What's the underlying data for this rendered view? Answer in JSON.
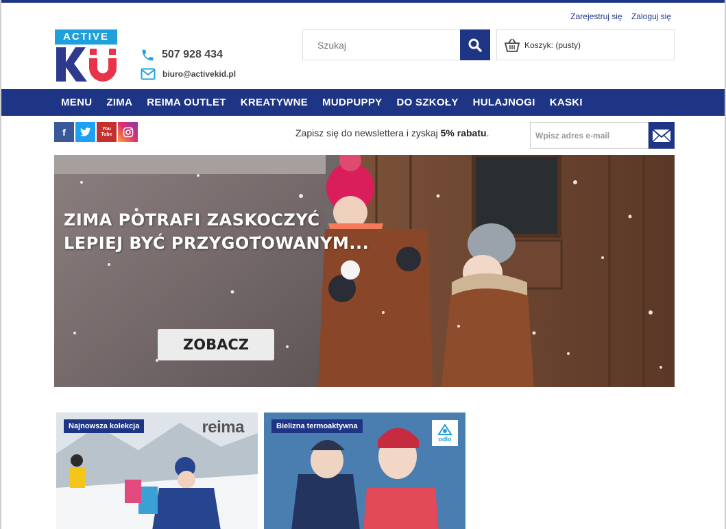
{
  "top_links": {
    "register": "Zarejestruj się",
    "login": "Zaloguj się"
  },
  "logo": {
    "word": "ACTIVE"
  },
  "contact": {
    "phone": "507 928 434",
    "email": "biuro@activekid.pl"
  },
  "search": {
    "placeholder": "Szukaj"
  },
  "cart": {
    "label": "Koszyk: (pusty)"
  },
  "nav": {
    "items": [
      "MENU",
      "ZIMA",
      "REIMA OUTLET",
      "KREATYWNE",
      "MUDPUPPY",
      "DO SZKOŁY",
      "HULAJNOGI",
      "KASKI"
    ]
  },
  "social": {
    "facebook": "f",
    "youtube": "You Tube"
  },
  "newsletter": {
    "text_before": "Zapisz się do newslettera i zyskaj ",
    "bold": "5% rabatu",
    "text_after": ".",
    "placeholder": "Wpisz adres e-mail"
  },
  "hero": {
    "line1": "ZIMA POTRAFI ZASKOCZYĆ",
    "line2": "LEPIEJ BYĆ PRZYGOTOWANYM...",
    "button": "ZOBACZ"
  },
  "promos": [
    {
      "tag": "Najnowsza kolekcja",
      "brand": "reima"
    },
    {
      "tag": "Bielizna termoaktywna",
      "brand": "odlo"
    }
  ],
  "colors": {
    "brand_blue": "#1e3586",
    "logo_cyan": "#1fa0dd",
    "logo_navy": "#2f3a8f",
    "logo_red": "#e8334a"
  }
}
